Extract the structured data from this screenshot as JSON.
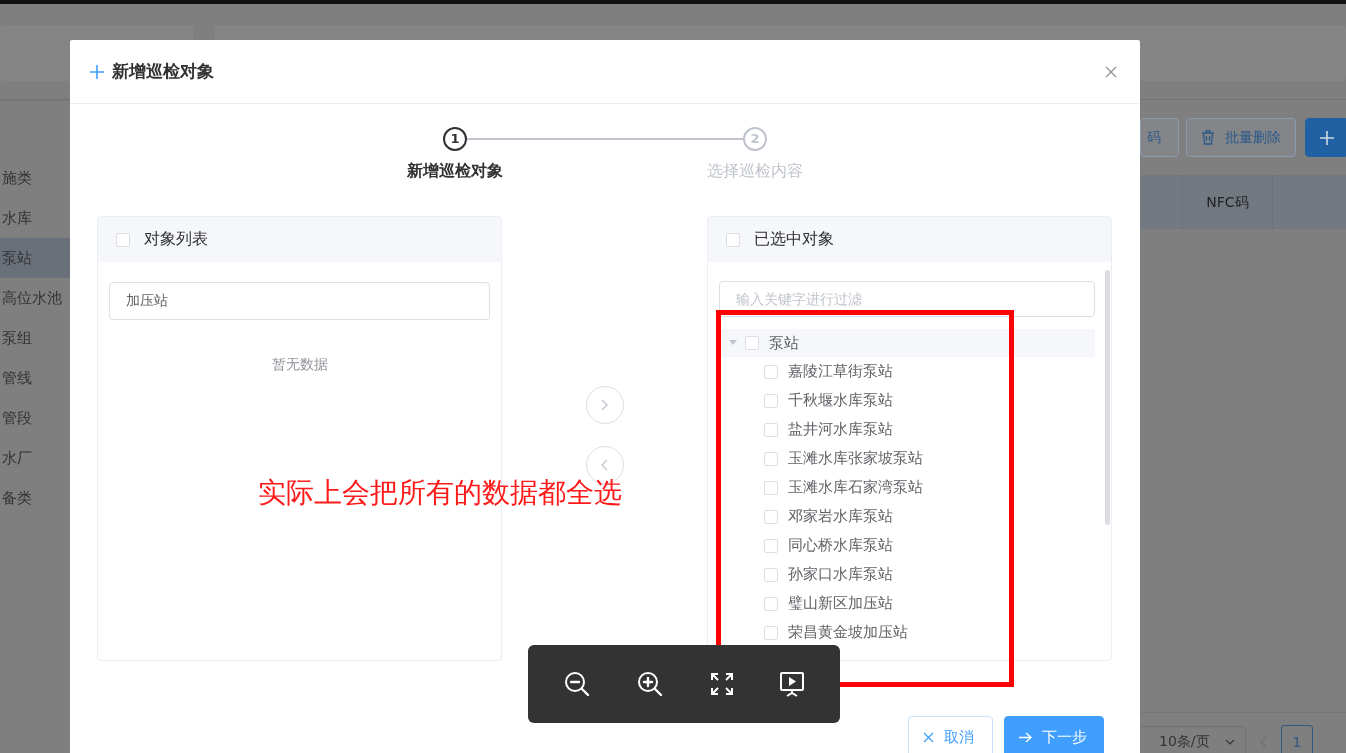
{
  "background": {
    "sidebar": [
      {
        "label": "施类",
        "selected": false
      },
      {
        "label": "水库",
        "selected": false
      },
      {
        "label": "泵站",
        "selected": true
      },
      {
        "label": "高位水池",
        "selected": false
      },
      {
        "label": "泵组",
        "selected": false
      },
      {
        "label": "管线",
        "selected": false
      },
      {
        "label": "管段",
        "selected": false
      },
      {
        "label": "水厂",
        "selected": false
      },
      {
        "label": "备类",
        "selected": false
      }
    ],
    "toolbar_buttons": [
      {
        "label": "码",
        "kind": "outline"
      },
      {
        "label": "批量删除",
        "kind": "delete"
      },
      {
        "kind": "add"
      }
    ],
    "table": {
      "columns": [
        "NFC码"
      ]
    },
    "pagination": {
      "page_size": "10条/页",
      "page": "1"
    }
  },
  "dialog": {
    "title": "新增巡检对象",
    "steps": [
      {
        "number": "1",
        "label": "新增巡检对象",
        "active": true
      },
      {
        "number": "2",
        "label": "选择巡检内容",
        "active": false
      }
    ],
    "source": {
      "title": "对象列表",
      "checked": false,
      "filter": {
        "value": "加压站"
      },
      "empty_text": "暂无数据"
    },
    "target": {
      "title": "已选中对象",
      "checked": false,
      "filter": {
        "placeholder": "输入关键字进行过滤"
      },
      "tree": [
        {
          "label": "泵站",
          "checked": false,
          "expanded": true,
          "children": [
            {
              "label": "嘉陵江草街泵站",
              "checked": false
            },
            {
              "label": "千秋堰水库泵站",
              "checked": false
            },
            {
              "label": "盐井河水库泵站",
              "checked": false
            },
            {
              "label": "玉滩水库张家坡泵站",
              "checked": false
            },
            {
              "label": "玉滩水库石家湾泵站",
              "checked": false
            },
            {
              "label": "邓家岩水库泵站",
              "checked": false
            },
            {
              "label": "同心桥水库泵站",
              "checked": false
            },
            {
              "label": "孙家口水库泵站",
              "checked": false
            },
            {
              "label": "璧山新区加压站",
              "checked": false
            },
            {
              "label": "荣昌黄金坡加压站",
              "checked": false
            }
          ]
        }
      ]
    },
    "buttons": [
      {
        "label": "取消",
        "kind": "cancel"
      },
      {
        "label": "下一步",
        "kind": "next"
      }
    ]
  },
  "annotation": {
    "text": "实际上会把所有的数据都全选"
  }
}
